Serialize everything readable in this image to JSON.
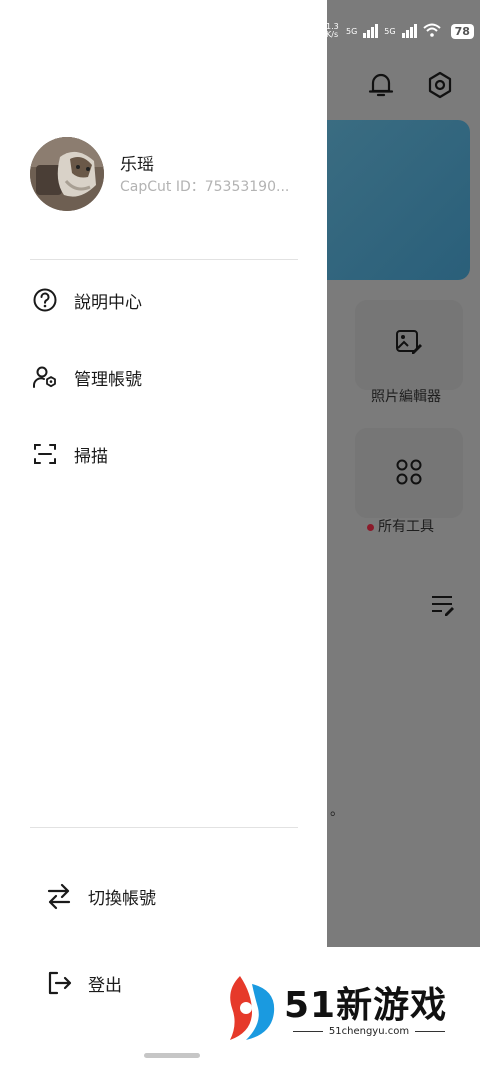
{
  "status_bar": {
    "network_1": "5G",
    "network_2": "5G",
    "speed": "1.3 K/s",
    "battery": "78"
  },
  "drawer": {
    "user": {
      "name": "乐瑶",
      "id": "CapCut ID：75353190..."
    },
    "menu": [
      {
        "label": "說明中心",
        "icon": "help-circle-icon"
      },
      {
        "label": "管理帳號",
        "icon": "manage-account-icon"
      },
      {
        "label": "掃描",
        "icon": "scan-icon"
      }
    ],
    "bottom_menu": [
      {
        "label": "切換帳號",
        "icon": "switch-arrows-icon"
      },
      {
        "label": "登出",
        "icon": "logout-icon"
      }
    ]
  },
  "background_app": {
    "tiles": [
      {
        "label": "照片編輯器",
        "icon": "photo-edit-icon"
      },
      {
        "label": "所有工具",
        "icon": "grid-icon",
        "badge": "red-dot"
      }
    ],
    "stray_char": "。"
  },
  "watermark": {
    "brand": "51新游戏",
    "url": "51chengyu.com"
  }
}
